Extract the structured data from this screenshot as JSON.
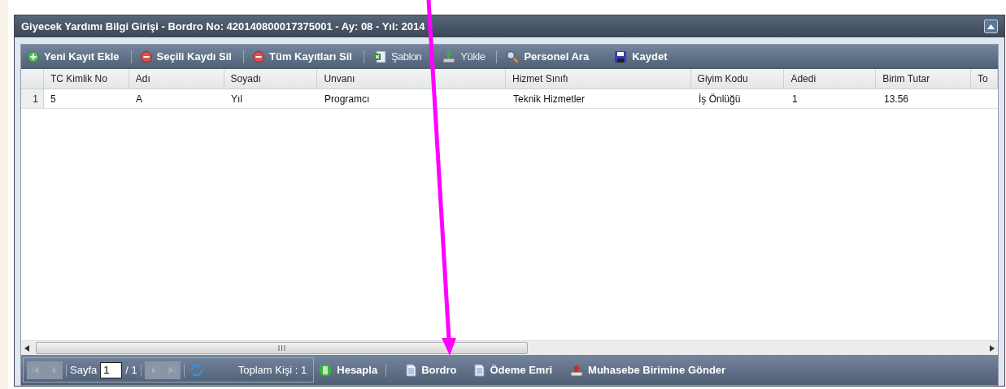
{
  "window": {
    "title": "Giyecek Yardımı Bilgi Girişi - Bordro No: 420140800017375001 - Ay: 08 - Yıl: 2014"
  },
  "toolbar": [
    {
      "label": "Yeni Kayıt Ekle",
      "kind": "add",
      "disabled": false
    },
    {
      "label": "Seçili Kaydı Sil",
      "kind": "delete",
      "disabled": false
    },
    {
      "label": "Tüm Kayıtları Sil",
      "kind": "delete",
      "disabled": false
    },
    {
      "label": "Şablon",
      "kind": "excel",
      "disabled": true
    },
    {
      "label": "Yükle",
      "kind": "upload",
      "disabled": true
    },
    {
      "label": "Personel Ara",
      "kind": "search",
      "disabled": false
    },
    {
      "label": "Kaydet",
      "kind": "save",
      "disabled": false
    }
  ],
  "table": {
    "columns": [
      "TC Kimlik No",
      "Adı",
      "Soyadı",
      "Unvanı",
      "Hizmet Sınıfı",
      "Giyim Kodu",
      "Adedi",
      "Birim Tutar",
      "To"
    ],
    "rows": [
      {
        "number": "1",
        "cells": [
          "5",
          "A",
          "Yıl",
          "Programcı",
          "Teknik Hizmetler",
          "İş Önlüğü",
          "1",
          "13.56"
        ]
      }
    ]
  },
  "paging": {
    "first_disabled": true,
    "prev_disabled": true,
    "next_disabled": true,
    "last_disabled": true,
    "page_label": "Sayfa",
    "page": "1",
    "page_count": "/ 1",
    "total": "Toplam Kişi : 1"
  },
  "actions": [
    {
      "label": "Hesapla",
      "kind": "calc"
    },
    {
      "label": "Bordro",
      "kind": "doc"
    },
    {
      "label": "Ödeme Emri",
      "kind": "doc"
    },
    {
      "label": "Muhasebe Birimine Gönder",
      "kind": "send"
    }
  ]
}
